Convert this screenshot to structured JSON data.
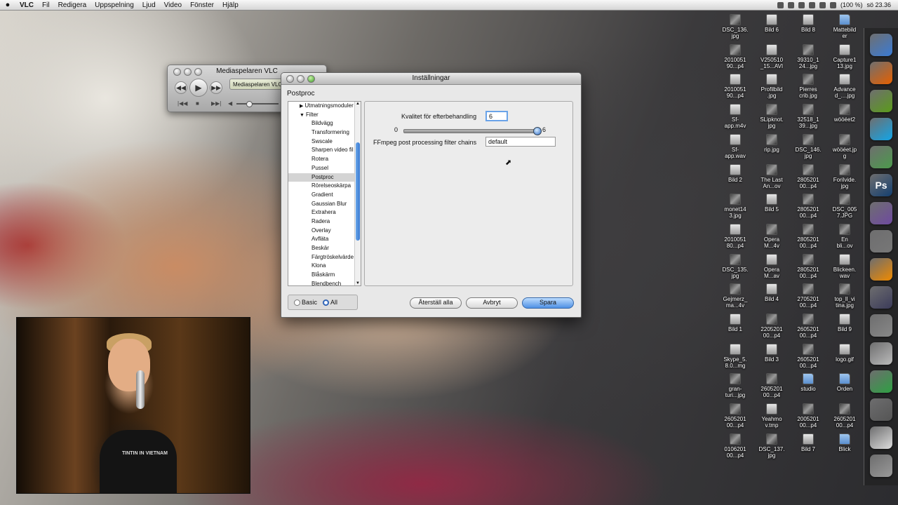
{
  "menubar": {
    "apple": "",
    "items": [
      "VLC",
      "Fil",
      "Redigera",
      "Uppspelning",
      "Ljud",
      "Video",
      "Fönster",
      "Hjälp"
    ],
    "battery": "(100 %)",
    "clock": "sö 23.36"
  },
  "miniplayer": {
    "title": "Mediaspelaren VLC",
    "lcd": "Mediaspelaren VLC"
  },
  "prefs": {
    "title": "Inställningar",
    "section": "Postproc",
    "tree": [
      {
        "label": "Utmatningsmoduler",
        "level": 0,
        "arrow": "▶"
      },
      {
        "label": "Filter",
        "level": 0,
        "arrow": "▼"
      },
      {
        "label": "Bildvägg",
        "level": 1
      },
      {
        "label": "Transformering",
        "level": 1
      },
      {
        "label": "Swscale",
        "level": 1
      },
      {
        "label": "Sharpen video fil",
        "level": 1
      },
      {
        "label": "Rotera",
        "level": 1
      },
      {
        "label": "Pussel",
        "level": 1
      },
      {
        "label": "Postproc",
        "level": 1,
        "selected": true
      },
      {
        "label": "Rörelseoskärpa",
        "level": 1
      },
      {
        "label": "Gradient",
        "level": 1
      },
      {
        "label": "Gaussian Blur",
        "level": 1
      },
      {
        "label": "Extrahera",
        "level": 1
      },
      {
        "label": "Radera",
        "level": 1
      },
      {
        "label": "Overlay",
        "level": 1
      },
      {
        "label": "Avfläta",
        "level": 1
      },
      {
        "label": "Beskär",
        "level": 1
      },
      {
        "label": "Färgtröskelvärde",
        "level": 1
      },
      {
        "label": "Klona",
        "level": 1
      },
      {
        "label": "Blåskärm",
        "level": 1
      },
      {
        "label": "Blendbench",
        "level": 1
      }
    ],
    "quality_label": "Kvalitet för efterbehandling",
    "quality_value": "6",
    "slider_min": "0",
    "slider_max": "6",
    "slider_value": 6,
    "ffmpeg_label": "FFmpeg post processing filter chains",
    "ffmpeg_value": "default",
    "radio_basic": "Basic",
    "radio_all": "All",
    "reset_button": "Återställ alla",
    "cancel_button": "Avbryt",
    "save_button": "Spara"
  },
  "webcam": {
    "shirt_text": "TINTIN IN VIETNAM"
  },
  "desktop": {
    "icons": [
      {
        "label": "DSC_136.\njpg",
        "kind": "photo"
      },
      {
        "label": "Bild 6",
        "kind": "doc"
      },
      {
        "label": "Bild 8",
        "kind": "doc"
      },
      {
        "label": "Mattebild\ner",
        "kind": "folder"
      },
      {
        "label": "2010051\n90...p4",
        "kind": "photo"
      },
      {
        "label": "V250510\n_15...AVI",
        "kind": "doc"
      },
      {
        "label": "39310_1\n24...jpg",
        "kind": "photo"
      },
      {
        "label": "Capture1\n13.jpg",
        "kind": "doc"
      },
      {
        "label": "2010051\n90...p4",
        "kind": "doc"
      },
      {
        "label": "Profilbild\n.jpg",
        "kind": "doc"
      },
      {
        "label": "Pierres\ncrib.jpg",
        "kind": "photo"
      },
      {
        "label": "Advance\nd_....jpg",
        "kind": "doc"
      },
      {
        "label": "Sf-\napp.m4v",
        "kind": "doc"
      },
      {
        "label": "SLipknot.\njpg",
        "kind": "photo"
      },
      {
        "label": "32518_1\n39...jpg",
        "kind": "photo"
      },
      {
        "label": "wööéet2",
        "kind": "photo"
      },
      {
        "label": "Sf-\napp.wav",
        "kind": "doc"
      },
      {
        "label": "rip.jpg",
        "kind": "photo"
      },
      {
        "label": "DSC_146.\njpg",
        "kind": "photo"
      },
      {
        "label": "wööéet.jp\ng",
        "kind": "photo"
      },
      {
        "label": "Bild 2",
        "kind": "doc"
      },
      {
        "label": "The Last\nAn...ov",
        "kind": "photo"
      },
      {
        "label": "2805201\n00...p4",
        "kind": "photo"
      },
      {
        "label": "Forilvide.\njpg",
        "kind": "photo"
      },
      {
        "label": "monet14\n3.jpg",
        "kind": "photo"
      },
      {
        "label": "Bild 5",
        "kind": "doc"
      },
      {
        "label": "2805201\n00...p4",
        "kind": "photo"
      },
      {
        "label": "DSC_005\n7.JPG",
        "kind": "photo"
      },
      {
        "label": "2010051\n80...p4",
        "kind": "doc"
      },
      {
        "label": "Opera\nM...4v",
        "kind": "photo"
      },
      {
        "label": "2805201\n00...p4",
        "kind": "photo"
      },
      {
        "label": "En\nbli...ov",
        "kind": "photo"
      },
      {
        "label": "DSC_135.\njpg",
        "kind": "photo"
      },
      {
        "label": "Opera\nM...av",
        "kind": "doc"
      },
      {
        "label": "2805201\n00...p4",
        "kind": "photo"
      },
      {
        "label": "Blickeen.\nwav",
        "kind": "doc"
      },
      {
        "label": "Gejmerz_\nma...4v",
        "kind": "photo"
      },
      {
        "label": "Bild 4",
        "kind": "doc"
      },
      {
        "label": "2705201\n00...p4",
        "kind": "photo"
      },
      {
        "label": "top_ll_vi\ntina.jpg",
        "kind": "photo"
      },
      {
        "label": "Bild 1",
        "kind": "doc"
      },
      {
        "label": "2205201\n00...p4",
        "kind": "photo"
      },
      {
        "label": "2605201\n00...p4",
        "kind": "photo"
      },
      {
        "label": "Bild 9",
        "kind": "doc"
      },
      {
        "label": "Skype_5.\n8.0...mg",
        "kind": "doc"
      },
      {
        "label": "Bild 3",
        "kind": "doc"
      },
      {
        "label": "2605201\n00...p4",
        "kind": "photo"
      },
      {
        "label": "logo.gif",
        "kind": "doc"
      },
      {
        "label": "gran-\nturi...jpg",
        "kind": "photo"
      },
      {
        "label": "2605201\n00...p4",
        "kind": "photo"
      },
      {
        "label": "studio",
        "kind": "folder"
      },
      {
        "label": "Orden",
        "kind": "folder"
      },
      {
        "label": "2605201\n00...p4",
        "kind": "photo"
      },
      {
        "label": "Yeahmo\nv.tmp",
        "kind": "doc"
      },
      {
        "label": "2005201\n00...p4",
        "kind": "photo"
      },
      {
        "label": "2605201\n00...p4",
        "kind": "photo"
      },
      {
        "label": "0106201\n00...p4",
        "kind": "photo"
      },
      {
        "label": "DSC_137.\njpg",
        "kind": "photo"
      },
      {
        "label": "Bild 7",
        "kind": "doc"
      },
      {
        "label": "Blick",
        "kind": "folder"
      }
    ]
  },
  "dock": {
    "icons": [
      {
        "name": "finder-icon",
        "color": "#3a7bd5"
      },
      {
        "name": "firefox-icon",
        "color": "#e66000"
      },
      {
        "name": "spotify-icon",
        "color": "#5b9b1a"
      },
      {
        "name": "skype-icon",
        "color": "#12a5e8"
      },
      {
        "name": "contacts-icon",
        "color": "#4c9a4c"
      },
      {
        "name": "photoshop-icon",
        "color": "#143f6f",
        "glyph": "Ps"
      },
      {
        "name": "imovie-icon",
        "color": "#6f4aa0"
      },
      {
        "name": "system-preferences-icon",
        "color": "#777777"
      },
      {
        "name": "vlc-icon",
        "color": "#f08a00"
      },
      {
        "name": "guitar-icon",
        "color": "#3b3b5a"
      },
      {
        "name": "camera-icon",
        "color": "#888888"
      },
      {
        "name": "bulb-icon",
        "color": "#bbbbbb"
      },
      {
        "name": "chrome-icon",
        "color": "#2ea043"
      },
      {
        "name": "mic-icon",
        "color": "#555555"
      },
      {
        "name": "zip-icon",
        "color": "#dddddd"
      },
      {
        "name": "trash-icon",
        "color": "#999999"
      }
    ]
  }
}
